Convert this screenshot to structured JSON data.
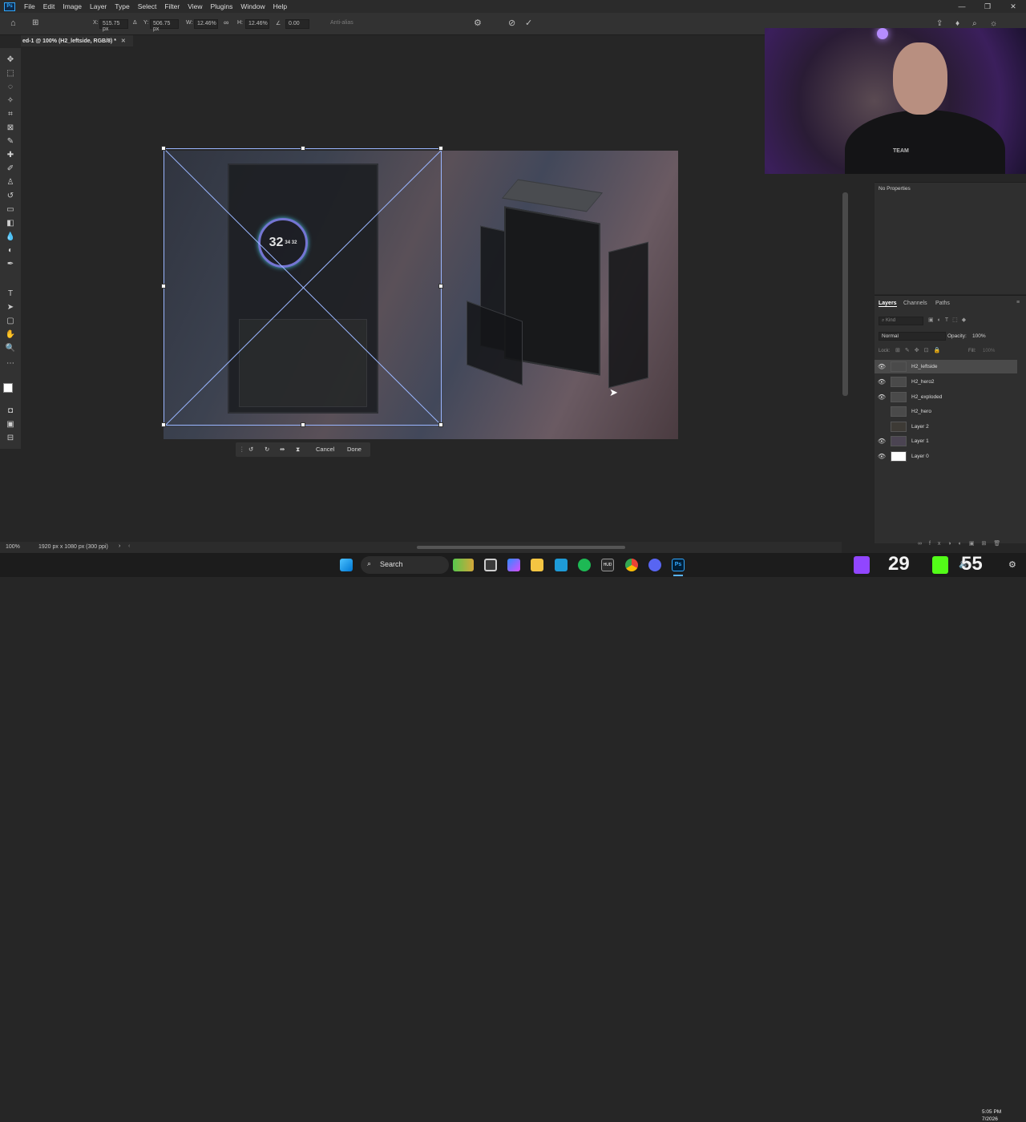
{
  "menubar": {
    "app_logo": "Ps",
    "items": [
      "File",
      "Edit",
      "Image",
      "Layer",
      "Type",
      "Select",
      "Filter",
      "View",
      "Plugins",
      "Window",
      "Help"
    ],
    "window_controls": [
      "—",
      "❐",
      "✕"
    ]
  },
  "options": {
    "x_label": "X:",
    "x_value": "515.75 px",
    "y_label": "Y:",
    "y_value": "506.75 px",
    "w_label": "W:",
    "w_value": "12.46%",
    "h_label": "H:",
    "h_value": "12.46%",
    "angle_value": "0.00",
    "interp_label": "Anti-alias"
  },
  "document": {
    "tab_title": "ed-1 @ 100% (H2_leftside, RGB/8) *",
    "close_glyph": "✕"
  },
  "canvas": {
    "ring_temp": "32",
    "ring_sub": "34 32"
  },
  "transform_bar": {
    "cancel_label": "Cancel",
    "done_label": "Done"
  },
  "webcam": {
    "shirt_text": "TEAM"
  },
  "properties": {
    "empty_label": "No Properties"
  },
  "layers_panel": {
    "tabs": [
      "Layers",
      "Channels",
      "Paths"
    ],
    "kind_placeholder": "Kind",
    "blend_mode": "Normal",
    "opacity_label": "Opacity:",
    "opacity_value": "100%",
    "lock_label": "Lock:",
    "fill_label": "Fill:",
    "fill_value": "100%",
    "layers": [
      {
        "name": "H2_leftside",
        "visible": true,
        "selected": true
      },
      {
        "name": "H2_hero2",
        "visible": true,
        "selected": false
      },
      {
        "name": "H2_exploded",
        "visible": true,
        "selected": false
      },
      {
        "name": "H2_hero",
        "visible": false,
        "selected": false
      },
      {
        "name": "Layer 2",
        "visible": false,
        "selected": false
      },
      {
        "name": "Layer 1",
        "visible": true,
        "selected": false
      },
      {
        "name": "Layer 0",
        "visible": true,
        "selected": false
      }
    ]
  },
  "status": {
    "zoom": "100%",
    "doc_info": "1920 px x 1080 px (300 ppi)"
  },
  "taskbar": {
    "search_label": "Search",
    "overlay_left": "29",
    "overlay_right": "55",
    "clock_time": "5:05 PM",
    "clock_date": "7/2026"
  },
  "colors": {
    "accent": "#31a8ff",
    "twitch": "#9146ff",
    "kick": "#53fc18"
  }
}
